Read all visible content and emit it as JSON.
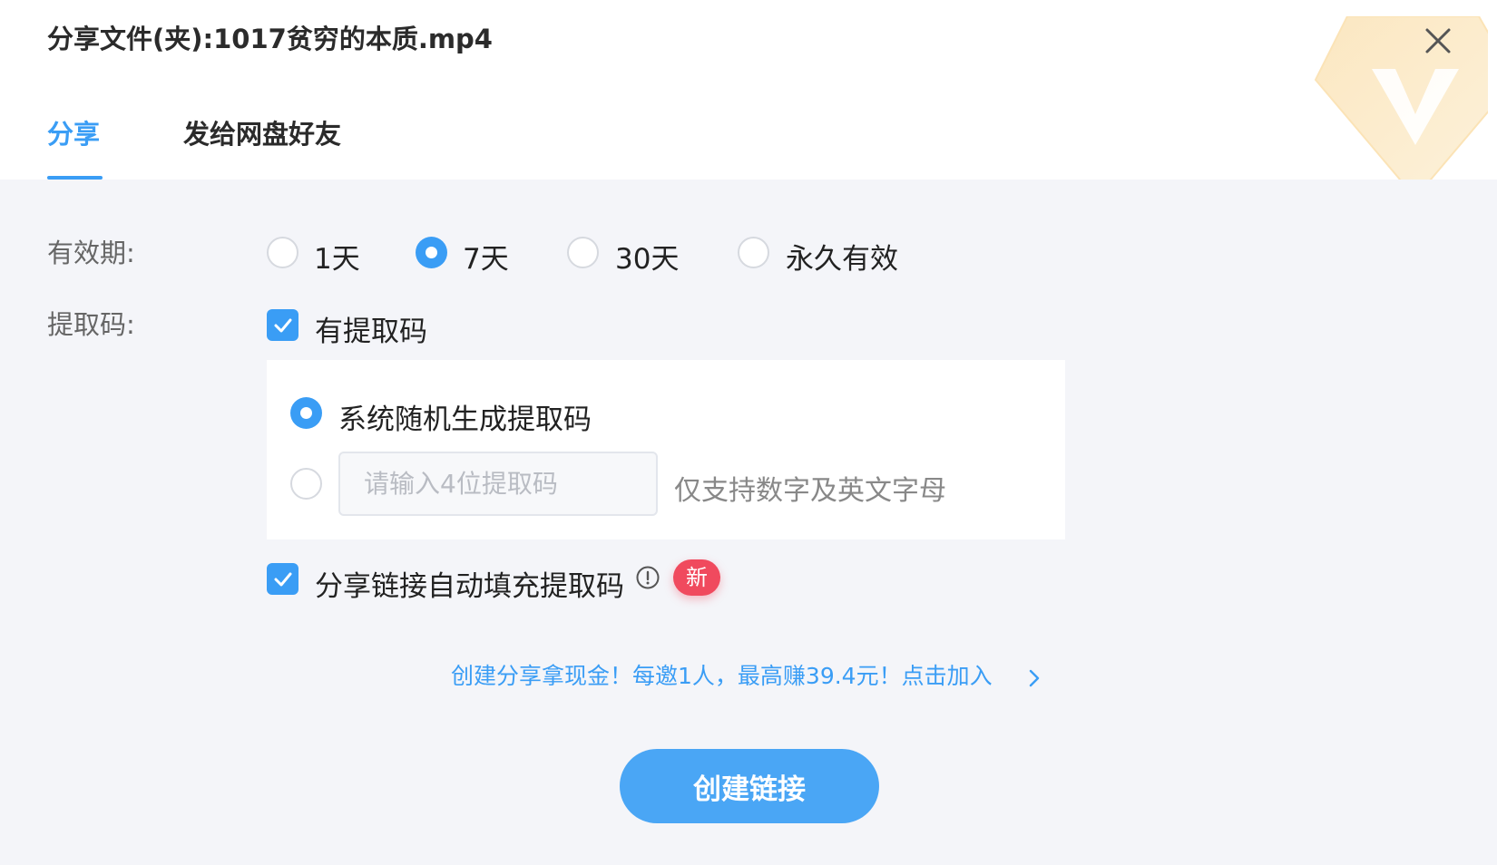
{
  "dialog": {
    "title": "分享文件(夹):1017贫穷的本质.mp4",
    "close_icon": "close-icon",
    "watermark_icon": "vip-diamond-icon"
  },
  "tabs": [
    {
      "label": "分享",
      "active": true
    },
    {
      "label": "发给网盘好友",
      "active": false
    }
  ],
  "validity": {
    "label": "有效期:",
    "options": [
      {
        "label": "1天",
        "selected": false
      },
      {
        "label": "7天",
        "selected": true
      },
      {
        "label": "30天",
        "selected": false
      },
      {
        "label": "永久有效",
        "selected": false
      }
    ]
  },
  "extract_code": {
    "label": "提取码:",
    "has_code_label": "有提取码",
    "has_code_checked": true,
    "random_option_label": "系统随机生成提取码",
    "random_selected": true,
    "custom_selected": false,
    "custom_placeholder": "请输入4位提取码",
    "custom_value": "",
    "hint": "仅支持数字及英文字母",
    "autofill_label": "分享链接自动填充提取码",
    "autofill_checked": true,
    "new_badge": "新"
  },
  "promo": {
    "text": "创建分享拿现金！每邀1人，最高赚39.4元！点击加入",
    "arrow_icon": "chevron-right-icon"
  },
  "create_button": "创建链接",
  "colors": {
    "accent": "#3a9df5",
    "badge": "#f04a5e",
    "background": "#f4f5f9"
  }
}
